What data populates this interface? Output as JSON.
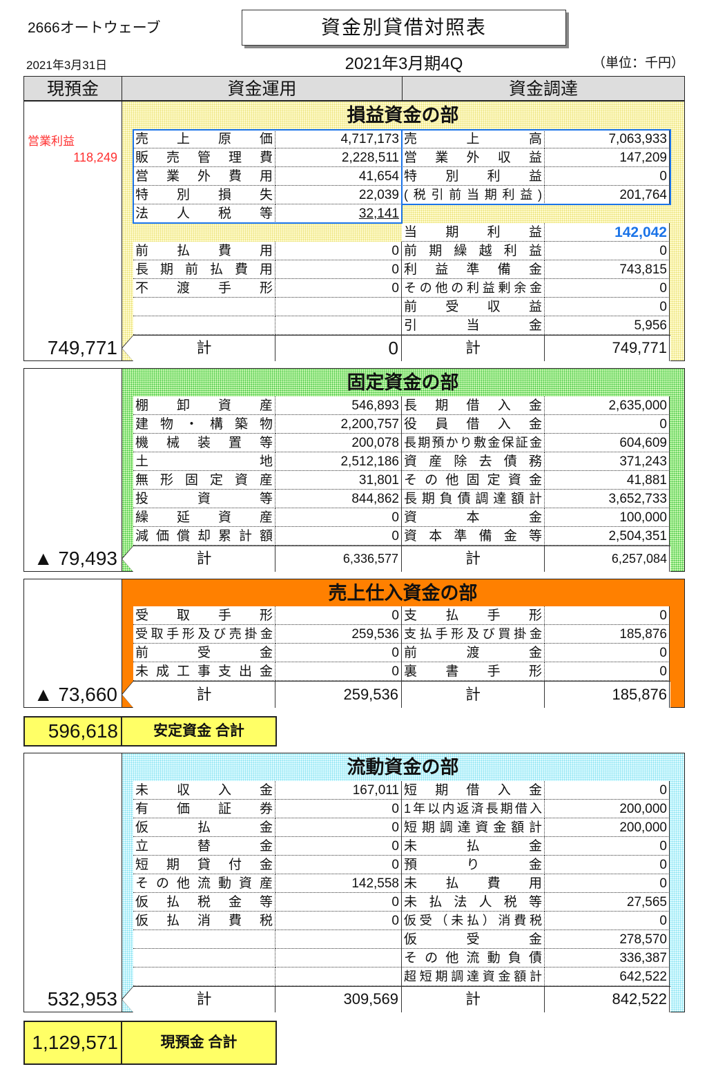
{
  "header": {
    "company": "2666オートウェーブ",
    "title": "資金別貸借対照表",
    "date": "2021年3月31日",
    "period": "2021年3月期4Q",
    "unit": "（単位：千円）"
  },
  "columns": {
    "cash": "現預金",
    "use": "資金運用",
    "source": "資金調達"
  },
  "colors": {
    "profit": "#fffbd0",
    "fixed": "#c8f7b0",
    "sales": "#ff8000",
    "current": "#e0fbff",
    "highlight": "#ffff66",
    "accent_blue": "#1a73e8",
    "red": "#ff3030"
  },
  "operating_profit": {
    "label": "営業利益",
    "value": "118,249"
  },
  "sections": [
    {
      "title": "損益資金の部",
      "cash": "749,771",
      "left": [
        [
          "売上原価",
          "4,717,173"
        ],
        [
          "販売管理費",
          "2,228,511"
        ],
        [
          "営業外費用",
          "41,654"
        ],
        [
          "特別損失",
          "22,039"
        ],
        [
          "法人税等",
          "32,141"
        ],
        null,
        [
          "前払費用",
          "0"
        ],
        [
          "長期前払費用",
          "0"
        ],
        [
          "不渡手形",
          "0"
        ],
        [
          "",
          ""
        ],
        [
          "",
          ""
        ]
      ],
      "right": [
        [
          "売上高",
          "7,063,933"
        ],
        [
          "営業外収益",
          "147,209"
        ],
        [
          "特別利益",
          "0"
        ],
        [
          "(税引前当期利益)",
          "201,764"
        ],
        null,
        [
          "当期利益",
          "142,042"
        ],
        [
          "前期繰越利益",
          "0"
        ],
        [
          "利益準備金",
          "743,815"
        ],
        [
          "その他の利益剰余金",
          "0"
        ],
        [
          "前受収益",
          "0"
        ],
        [
          "引当金",
          "5,956"
        ]
      ],
      "total_label": "計",
      "left_total": "0",
      "right_total": "749,771"
    },
    {
      "title": "固定資金の部",
      "cash": "▲ 79,493",
      "left": [
        [
          "棚卸資産",
          "546,893"
        ],
        [
          "建物・構築物",
          "2,200,757"
        ],
        [
          "機械装置等",
          "200,078"
        ],
        [
          "土地",
          "2,512,186"
        ],
        [
          "無形固定資産",
          "31,801"
        ],
        [
          "投資等",
          "844,862"
        ],
        [
          "繰延資産",
          "0"
        ],
        [
          "減価償却累計額",
          "0"
        ]
      ],
      "right": [
        [
          "長期借入金",
          "2,635,000"
        ],
        [
          "役員借入金",
          "0"
        ],
        [
          "長期預かり敷金保証金",
          "604,609"
        ],
        [
          "資産除去債務",
          "371,243"
        ],
        [
          "その他固定資金",
          "41,881"
        ],
        [
          "長期負債調達額計",
          "3,652,733"
        ],
        [
          "資本金",
          "100,000"
        ],
        [
          "資本準備金等",
          "2,504,351"
        ]
      ],
      "total_label": "計",
      "left_total": "6,336,577",
      "right_total": "6,257,084"
    },
    {
      "title": "売上仕入資金の部",
      "cash": "▲ 73,660",
      "left": [
        [
          "受取手形",
          "0"
        ],
        [
          "受取手形及び売掛金",
          "259,536"
        ],
        [
          "前受金",
          "0"
        ],
        [
          "未成工事支出金",
          "0"
        ]
      ],
      "right": [
        [
          "支払手形",
          "0"
        ],
        [
          "支払手形及び買掛金",
          "185,876"
        ],
        [
          "前渡金",
          "0"
        ],
        [
          "裏書手形",
          "0"
        ]
      ],
      "total_label": "計",
      "left_total": "259,536",
      "right_total": "185,876"
    },
    {
      "title": "流動資金の部",
      "cash": "532,953",
      "left": [
        [
          "未収入金",
          "167,011"
        ],
        [
          "有価証券",
          "0"
        ],
        [
          "仮払金",
          "0"
        ],
        [
          "立替金",
          "0"
        ],
        [
          "短期貸付金",
          "0"
        ],
        [
          "その他流動資産",
          "142,558"
        ],
        [
          "仮払税金等",
          "0"
        ],
        [
          "仮払消費税",
          "0"
        ],
        [
          "",
          ""
        ],
        [
          "",
          ""
        ],
        [
          "",
          ""
        ]
      ],
      "right": [
        [
          "短期借入金",
          "0"
        ],
        [
          "1年以内返済長期借入",
          "200,000"
        ],
        [
          "短期調達資金額計",
          "200,000"
        ],
        [
          "未払金",
          "0"
        ],
        [
          "預り金",
          "0"
        ],
        [
          "未払費用",
          "0"
        ],
        [
          "未払法人税等",
          "27,565"
        ],
        [
          "仮受（未払）消費税",
          "0"
        ],
        [
          "仮受金",
          "278,570"
        ],
        [
          "その他流動負債",
          "336,387"
        ],
        [
          "超短期調達資金額計",
          "642,522"
        ]
      ],
      "total_label": "計",
      "left_total": "309,569",
      "right_total": "842,522"
    }
  ],
  "stable_total": {
    "value": "596,618",
    "label": "安定資金 合計"
  },
  "cash_total": {
    "value": "1,129,571",
    "label": "現預金 合計"
  }
}
